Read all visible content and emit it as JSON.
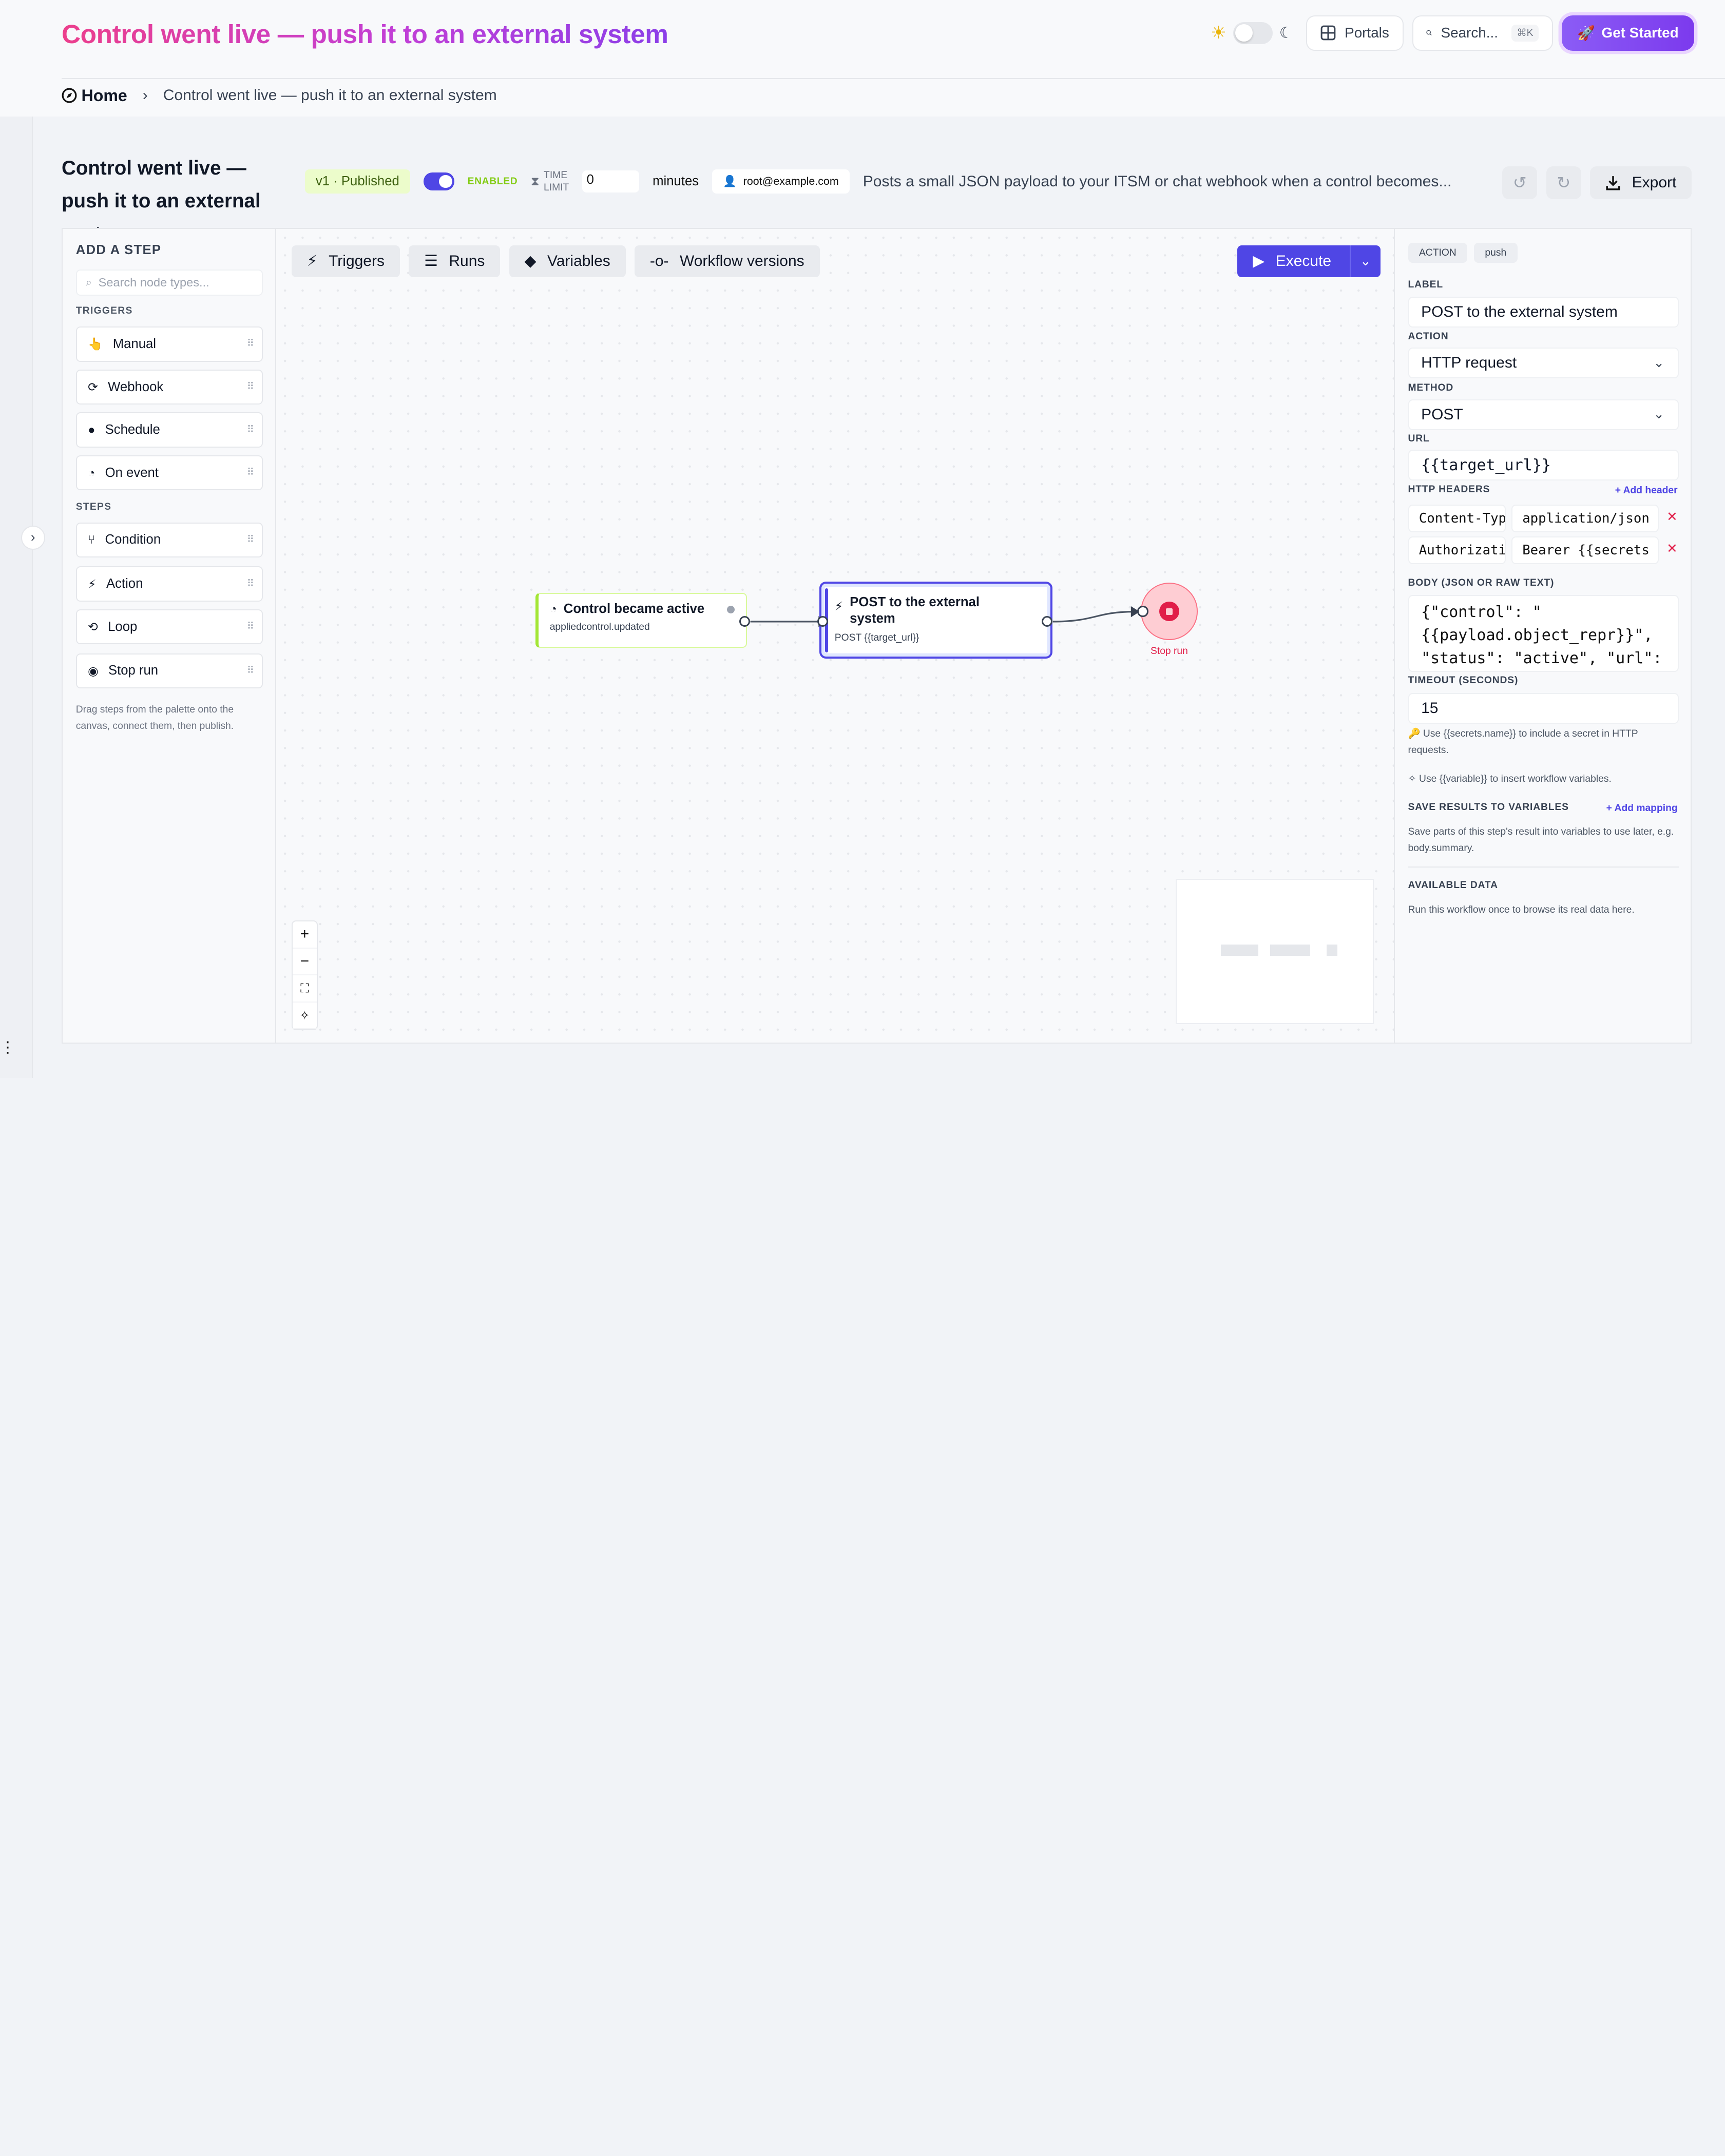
{
  "header": {
    "title": "Control went live — push it to an external system",
    "portals_label": "Portals",
    "search_label": "Search...",
    "search_shortcut": "⌘K",
    "get_started_label": "Get Started"
  },
  "breadcrumb": {
    "home": "Home",
    "separator": "›",
    "current": "Control went live — push it to an external system"
  },
  "workflow": {
    "title": "Control went live — push it to an external system",
    "version_badge": "v1 · Published",
    "enabled_label": "ENABLED",
    "time_limit_label_1": "TIME",
    "time_limit_label_2": "LIMIT",
    "time_limit_value": "0",
    "time_limit_unit": "minutes",
    "owner": "root@example.com",
    "description": "Posts a small JSON payload to your ITSM or chat webhook when a control becomes...",
    "export_label": "Export"
  },
  "palette": {
    "heading": "ADD A STEP",
    "search_placeholder": "Search node types...",
    "triggers_heading": "TRIGGERS",
    "triggers": [
      "Manual",
      "Webhook",
      "Schedule",
      "On event"
    ],
    "steps_heading": "STEPS",
    "steps": [
      "Condition",
      "Action",
      "Loop",
      "Stop run"
    ],
    "hint": "Drag steps from the palette onto the canvas, connect them, then publish."
  },
  "canvas": {
    "tabs": [
      "Triggers",
      "Runs",
      "Variables",
      "Workflow versions"
    ],
    "execute_label": "Execute",
    "trigger_node": {
      "title": "Control became active",
      "subtitle": "appliedcontrol.updated"
    },
    "action_node": {
      "title": "POST to the external system",
      "subtitle": "POST {{target_url}}"
    },
    "stop_node": {
      "label": "Stop run"
    }
  },
  "inspector": {
    "tag_type": "ACTION",
    "tag_key": "push",
    "label_heading": "LABEL",
    "label_value": "POST to the external system",
    "action_heading": "ACTION",
    "action_value": "HTTP request",
    "method_heading": "METHOD",
    "method_value": "POST",
    "url_heading": "URL",
    "url_value": "{{target_url}}",
    "headers_heading": "HTTP HEADERS",
    "add_header_label": "+ Add header",
    "headers": [
      {
        "key": "Content-Type",
        "value": "application/json"
      },
      {
        "key": "Authorization",
        "value": "Bearer {{secrets"
      }
    ],
    "body_heading": "BODY (JSON OR RAW TEXT)",
    "body_value": "{\"control\": \"{{payload.object_repr}}\", \"status\": \"active\", \"url\": \"{{payload.url}}\"}",
    "timeout_heading": "TIMEOUT (SECONDS)",
    "timeout_value": "15",
    "help_secrets": "Use {{secrets.name}} to include a secret in HTTP requests.",
    "help_variables": "Use {{variable}} to insert workflow variables.",
    "save_heading": "SAVE RESULTS TO VARIABLES",
    "add_mapping_label": "+ Add mapping",
    "save_help": "Save parts of this step's result into variables to use later, e.g. body.summary.",
    "available_heading": "AVAILABLE DATA",
    "available_help": "Run this workflow once to browse its real data here."
  }
}
